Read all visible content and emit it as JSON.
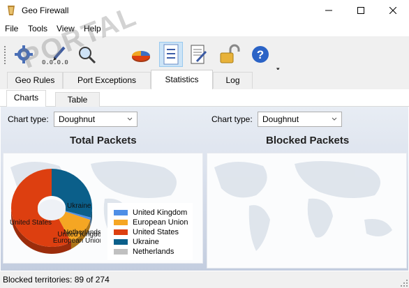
{
  "window": {
    "title": "Geo Firewall",
    "controls": [
      "minimize",
      "maximize",
      "close"
    ]
  },
  "menu": [
    "File",
    "Tools",
    "View",
    "Help"
  ],
  "toolbar": {
    "buttons": [
      "gear-icon",
      "edit-ip-icon",
      "search-icon",
      "pie-chart-icon",
      "list-icon",
      "document-icon",
      "unlock-icon",
      "help-icon"
    ],
    "active": "list-icon"
  },
  "watermark": "PORTAL",
  "tabs": {
    "items": [
      "Geo Rules",
      "Port Exceptions",
      "Statistics",
      "Log"
    ],
    "active": "Statistics"
  },
  "subtabs": {
    "items": [
      "Charts",
      "Table"
    ],
    "active": "Charts"
  },
  "charts": {
    "left": {
      "chart_type_label": "Chart type:",
      "chart_type_value": "Doughnut",
      "title": "Total Packets"
    },
    "right": {
      "chart_type_label": "Chart type:",
      "chart_type_value": "Doughnut",
      "title": "Blocked Packets"
    }
  },
  "chart_data": {
    "type": "pie",
    "variant": "doughnut",
    "title": "Total Packets",
    "categories": [
      "United Kingdom",
      "European Union",
      "United States",
      "Ukraine",
      "Netherlands"
    ],
    "values": [
      1,
      12,
      58,
      29,
      0
    ],
    "colors": [
      "#4f8fe6",
      "#f5a623",
      "#dd3f10",
      "#0b5f8a",
      "#c0c0c0"
    ],
    "slice_labels": [
      "United Kingdom",
      "European Union",
      "United States",
      "Ukraine",
      "Netherlands"
    ],
    "legend_position": "right"
  },
  "status": {
    "text": "Blocked territories: 89 of 274"
  }
}
